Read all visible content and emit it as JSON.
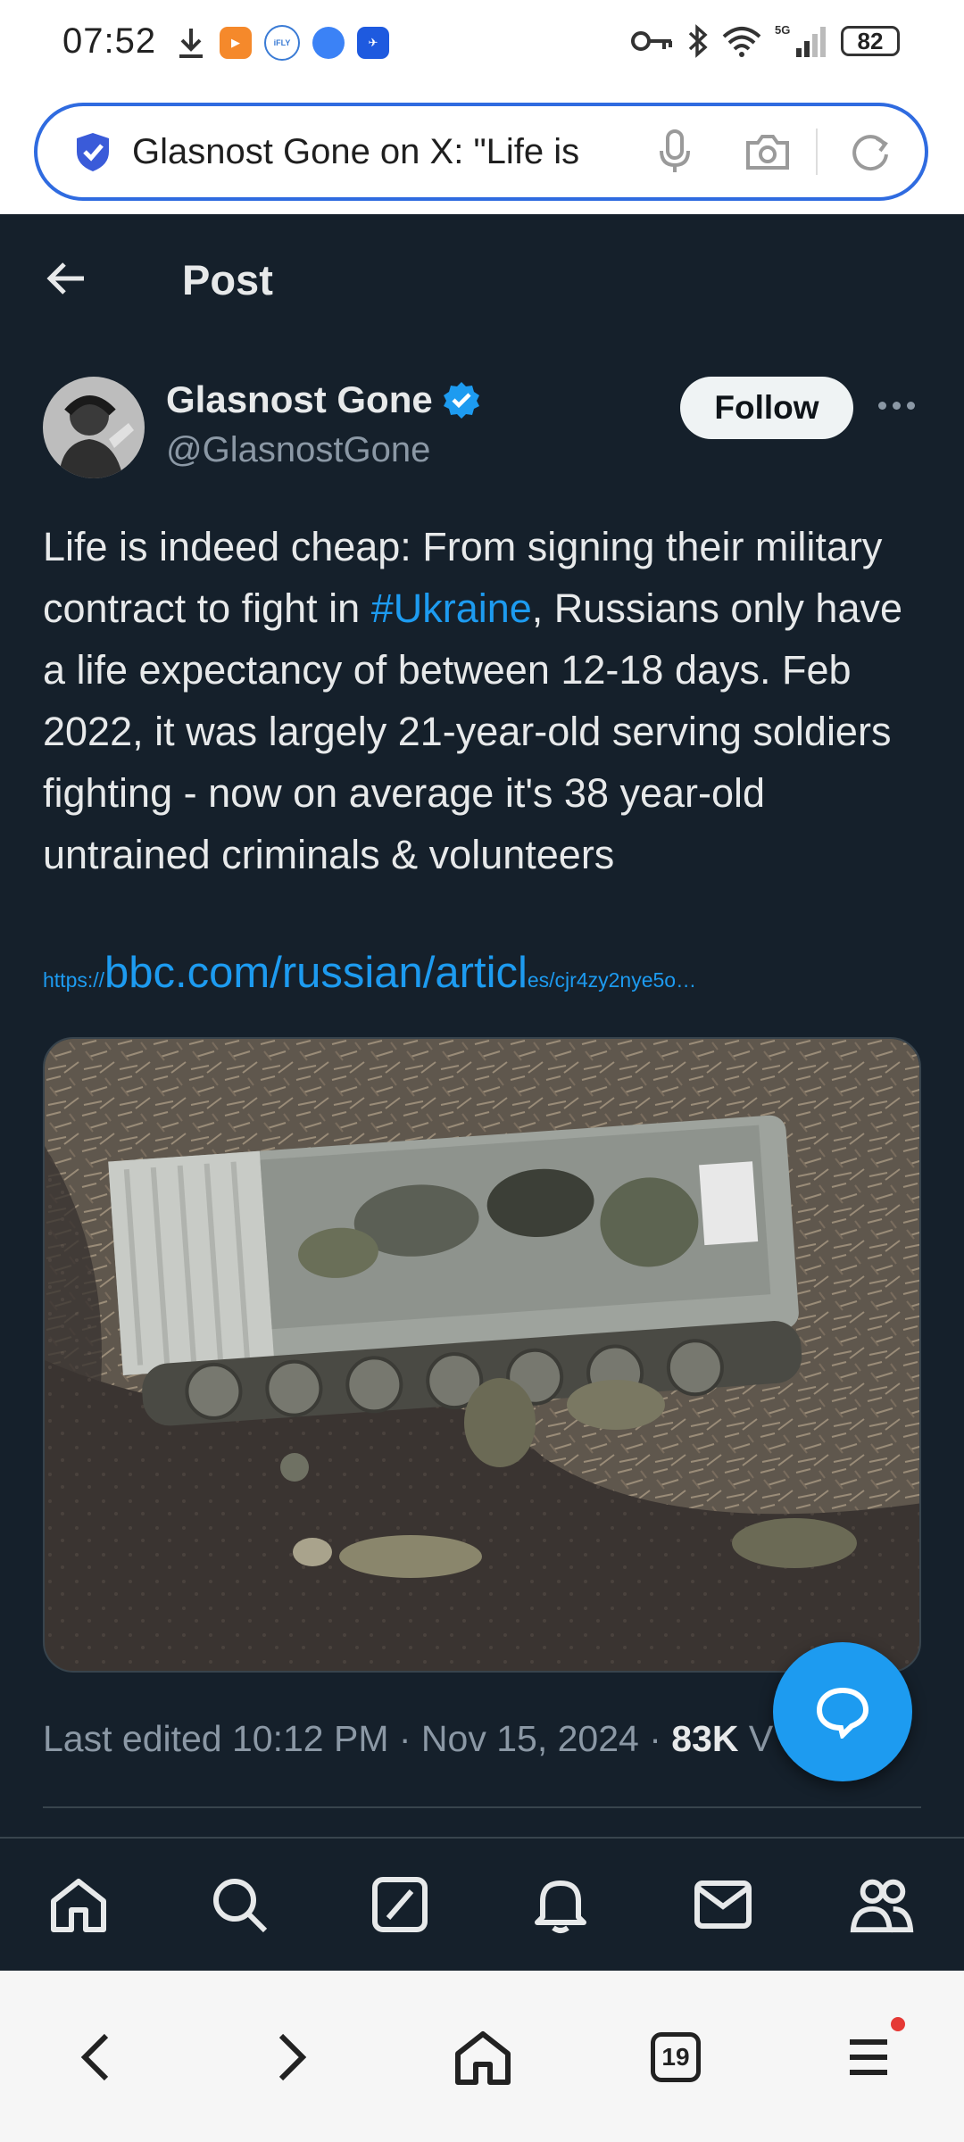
{
  "status_bar": {
    "time": "07:52",
    "battery": "82",
    "network": "5G"
  },
  "browser": {
    "url_text": "Glasnost Gone on X: \"Life is",
    "tab_count": "19"
  },
  "header": {
    "title": "Post"
  },
  "author": {
    "name": "Glasnost Gone",
    "handle": "@GlasnostGone",
    "follow_label": "Follow"
  },
  "tweet": {
    "text_before": "Life is indeed cheap: From signing their military contract to fight in ",
    "hashtag": "#Ukraine",
    "text_after": ", Russians only have a life expectancy of between 12-18 days. Feb 2022, it was largely 21-year-old serving soldiers fighting - now on average it's 38 year-old untrained criminals & volunteers",
    "link_prefix": "https://",
    "link_main": "bbc.com/russian/articl",
    "link_suffix": "es/cjr4zy2nye5o…"
  },
  "meta": {
    "edited": "Last edited 10:12 PM · Nov 15, 2024 · ",
    "views": "83K",
    "views_suffix": " V"
  },
  "colors": {
    "background": "#15202b",
    "accent": "#1d9bf0",
    "text": "#e7e9ea",
    "muted": "#8b98a5"
  },
  "icons": {
    "bottom_nav": [
      "home-icon",
      "search-icon",
      "grok-icon",
      "notifications-icon",
      "messages-icon",
      "communities-icon"
    ],
    "browser_nav": [
      "back-icon",
      "forward-icon",
      "home-icon",
      "tabs-icon",
      "menu-icon"
    ]
  }
}
